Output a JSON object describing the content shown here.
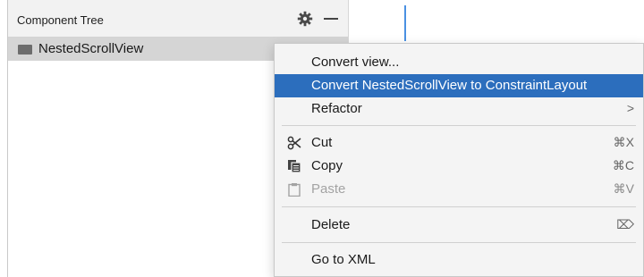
{
  "panel": {
    "title": "Component Tree",
    "tree_item": "NestedScrollView"
  },
  "menu": {
    "convert_view": "Convert view...",
    "convert_nested": "Convert NestedScrollView to ConstraintLayout",
    "refactor": "Refactor",
    "refactor_arrow": ">",
    "cut": "Cut",
    "cut_shortcut": "⌘X",
    "copy": "Copy",
    "copy_shortcut": "⌘C",
    "paste": "Paste",
    "paste_shortcut": "⌘V",
    "delete": "Delete",
    "delete_shortcut": "⌦",
    "go_to_xml": "Go to XML"
  },
  "colors": {
    "selection": "#2c6ebd",
    "accent_line": "#4a90e2"
  },
  "icons": {
    "settings": "gear-icon",
    "collapse": "minus-icon",
    "cut": "scissors-icon",
    "copy": "copy-icon",
    "paste": "clipboard-icon",
    "tree_item": "view-icon"
  }
}
